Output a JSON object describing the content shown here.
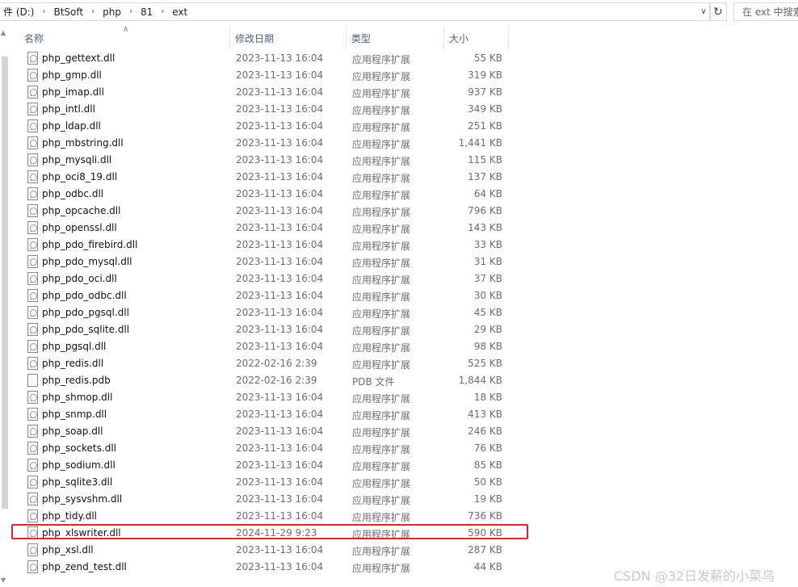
{
  "address": {
    "crumbs": [
      "件 (D:)",
      "BtSoft",
      "php",
      "81",
      "ext"
    ]
  },
  "search": {
    "placeholder": "在 ext 中搜索"
  },
  "columns": {
    "name": "名称",
    "date": "修改日期",
    "type": "类型",
    "size": "大小"
  },
  "files": [
    {
      "name": "php_gettext.dll",
      "date": "2023-11-13 16:04",
      "type": "应用程序扩展",
      "size": "55 KB",
      "icon": "dll-icon"
    },
    {
      "name": "php_gmp.dll",
      "date": "2023-11-13 16:04",
      "type": "应用程序扩展",
      "size": "319 KB",
      "icon": "dll-icon"
    },
    {
      "name": "php_imap.dll",
      "date": "2023-11-13 16:04",
      "type": "应用程序扩展",
      "size": "937 KB",
      "icon": "dll-icon"
    },
    {
      "name": "php_intl.dll",
      "date": "2023-11-13 16:04",
      "type": "应用程序扩展",
      "size": "349 KB",
      "icon": "dll-icon"
    },
    {
      "name": "php_ldap.dll",
      "date": "2023-11-13 16:04",
      "type": "应用程序扩展",
      "size": "251 KB",
      "icon": "dll-icon"
    },
    {
      "name": "php_mbstring.dll",
      "date": "2023-11-13 16:04",
      "type": "应用程序扩展",
      "size": "1,441 KB",
      "icon": "dll-icon"
    },
    {
      "name": "php_mysqli.dll",
      "date": "2023-11-13 16:04",
      "type": "应用程序扩展",
      "size": "115 KB",
      "icon": "dll-icon"
    },
    {
      "name": "php_oci8_19.dll",
      "date": "2023-11-13 16:04",
      "type": "应用程序扩展",
      "size": "137 KB",
      "icon": "dll-icon"
    },
    {
      "name": "php_odbc.dll",
      "date": "2023-11-13 16:04",
      "type": "应用程序扩展",
      "size": "64 KB",
      "icon": "dll-icon"
    },
    {
      "name": "php_opcache.dll",
      "date": "2023-11-13 16:04",
      "type": "应用程序扩展",
      "size": "796 KB",
      "icon": "dll-icon"
    },
    {
      "name": "php_openssl.dll",
      "date": "2023-11-13 16:04",
      "type": "应用程序扩展",
      "size": "143 KB",
      "icon": "dll-icon"
    },
    {
      "name": "php_pdo_firebird.dll",
      "date": "2023-11-13 16:04",
      "type": "应用程序扩展",
      "size": "33 KB",
      "icon": "dll-icon"
    },
    {
      "name": "php_pdo_mysql.dll",
      "date": "2023-11-13 16:04",
      "type": "应用程序扩展",
      "size": "31 KB",
      "icon": "dll-icon"
    },
    {
      "name": "php_pdo_oci.dll",
      "date": "2023-11-13 16:04",
      "type": "应用程序扩展",
      "size": "37 KB",
      "icon": "dll-icon"
    },
    {
      "name": "php_pdo_odbc.dll",
      "date": "2023-11-13 16:04",
      "type": "应用程序扩展",
      "size": "30 KB",
      "icon": "dll-icon"
    },
    {
      "name": "php_pdo_pgsql.dll",
      "date": "2023-11-13 16:04",
      "type": "应用程序扩展",
      "size": "45 KB",
      "icon": "dll-icon"
    },
    {
      "name": "php_pdo_sqlite.dll",
      "date": "2023-11-13 16:04",
      "type": "应用程序扩展",
      "size": "29 KB",
      "icon": "dll-icon"
    },
    {
      "name": "php_pgsql.dll",
      "date": "2023-11-13 16:04",
      "type": "应用程序扩展",
      "size": "98 KB",
      "icon": "dll-icon"
    },
    {
      "name": "php_redis.dll",
      "date": "2022-02-16 2:39",
      "type": "应用程序扩展",
      "size": "525 KB",
      "icon": "dll-icon"
    },
    {
      "name": "php_redis.pdb",
      "date": "2022-02-16 2:39",
      "type": "PDB 文件",
      "size": "1,844 KB",
      "icon": "file-icon"
    },
    {
      "name": "php_shmop.dll",
      "date": "2023-11-13 16:04",
      "type": "应用程序扩展",
      "size": "18 KB",
      "icon": "dll-icon"
    },
    {
      "name": "php_snmp.dll",
      "date": "2023-11-13 16:04",
      "type": "应用程序扩展",
      "size": "413 KB",
      "icon": "dll-icon"
    },
    {
      "name": "php_soap.dll",
      "date": "2023-11-13 16:04",
      "type": "应用程序扩展",
      "size": "246 KB",
      "icon": "dll-icon"
    },
    {
      "name": "php_sockets.dll",
      "date": "2023-11-13 16:04",
      "type": "应用程序扩展",
      "size": "76 KB",
      "icon": "dll-icon"
    },
    {
      "name": "php_sodium.dll",
      "date": "2023-11-13 16:04",
      "type": "应用程序扩展",
      "size": "85 KB",
      "icon": "dll-icon"
    },
    {
      "name": "php_sqlite3.dll",
      "date": "2023-11-13 16:04",
      "type": "应用程序扩展",
      "size": "50 KB",
      "icon": "dll-icon"
    },
    {
      "name": "php_sysvshm.dll",
      "date": "2023-11-13 16:04",
      "type": "应用程序扩展",
      "size": "19 KB",
      "icon": "dll-icon"
    },
    {
      "name": "php_tidy.dll",
      "date": "2023-11-13 16:04",
      "type": "应用程序扩展",
      "size": "736 KB",
      "icon": "dll-icon"
    },
    {
      "name": "php_xlswriter.dll",
      "date": "2024-11-29 9:23",
      "type": "应用程序扩展",
      "size": "590 KB",
      "icon": "dll-icon",
      "highlighted": true
    },
    {
      "name": "php_xsl.dll",
      "date": "2023-11-13 16:04",
      "type": "应用程序扩展",
      "size": "287 KB",
      "icon": "dll-icon"
    },
    {
      "name": "php_zend_test.dll",
      "date": "2023-11-13 16:04",
      "type": "应用程序扩展",
      "size": "44 KB",
      "icon": "dll-icon"
    }
  ],
  "highlight_color": "#e2212a",
  "watermark": "CSDN @32日发薪的小菜鸟"
}
